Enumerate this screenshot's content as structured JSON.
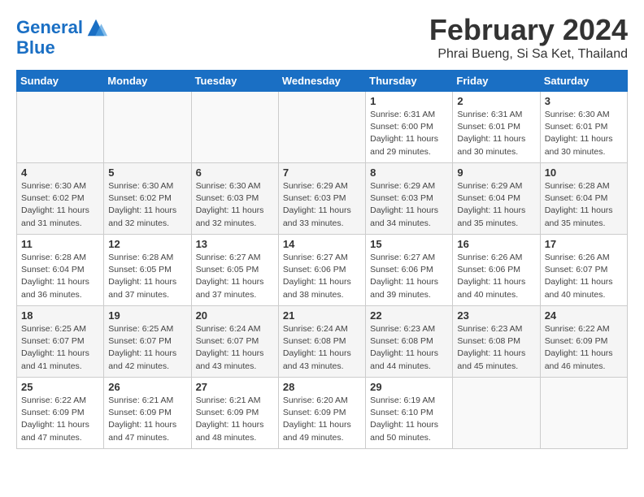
{
  "logo": {
    "line1": "General",
    "line2": "Blue"
  },
  "title": "February 2024",
  "subtitle": "Phrai Bueng, Si Sa Ket, Thailand",
  "days_of_week": [
    "Sunday",
    "Monday",
    "Tuesday",
    "Wednesday",
    "Thursday",
    "Friday",
    "Saturday"
  ],
  "weeks": [
    [
      {
        "day": "",
        "info": ""
      },
      {
        "day": "",
        "info": ""
      },
      {
        "day": "",
        "info": ""
      },
      {
        "day": "",
        "info": ""
      },
      {
        "day": "1",
        "info": "Sunrise: 6:31 AM\nSunset: 6:00 PM\nDaylight: 11 hours\nand 29 minutes."
      },
      {
        "day": "2",
        "info": "Sunrise: 6:31 AM\nSunset: 6:01 PM\nDaylight: 11 hours\nand 30 minutes."
      },
      {
        "day": "3",
        "info": "Sunrise: 6:30 AM\nSunset: 6:01 PM\nDaylight: 11 hours\nand 30 minutes."
      }
    ],
    [
      {
        "day": "4",
        "info": "Sunrise: 6:30 AM\nSunset: 6:02 PM\nDaylight: 11 hours\nand 31 minutes."
      },
      {
        "day": "5",
        "info": "Sunrise: 6:30 AM\nSunset: 6:02 PM\nDaylight: 11 hours\nand 32 minutes."
      },
      {
        "day": "6",
        "info": "Sunrise: 6:30 AM\nSunset: 6:03 PM\nDaylight: 11 hours\nand 32 minutes."
      },
      {
        "day": "7",
        "info": "Sunrise: 6:29 AM\nSunset: 6:03 PM\nDaylight: 11 hours\nand 33 minutes."
      },
      {
        "day": "8",
        "info": "Sunrise: 6:29 AM\nSunset: 6:03 PM\nDaylight: 11 hours\nand 34 minutes."
      },
      {
        "day": "9",
        "info": "Sunrise: 6:29 AM\nSunset: 6:04 PM\nDaylight: 11 hours\nand 35 minutes."
      },
      {
        "day": "10",
        "info": "Sunrise: 6:28 AM\nSunset: 6:04 PM\nDaylight: 11 hours\nand 35 minutes."
      }
    ],
    [
      {
        "day": "11",
        "info": "Sunrise: 6:28 AM\nSunset: 6:04 PM\nDaylight: 11 hours\nand 36 minutes."
      },
      {
        "day": "12",
        "info": "Sunrise: 6:28 AM\nSunset: 6:05 PM\nDaylight: 11 hours\nand 37 minutes."
      },
      {
        "day": "13",
        "info": "Sunrise: 6:27 AM\nSunset: 6:05 PM\nDaylight: 11 hours\nand 37 minutes."
      },
      {
        "day": "14",
        "info": "Sunrise: 6:27 AM\nSunset: 6:06 PM\nDaylight: 11 hours\nand 38 minutes."
      },
      {
        "day": "15",
        "info": "Sunrise: 6:27 AM\nSunset: 6:06 PM\nDaylight: 11 hours\nand 39 minutes."
      },
      {
        "day": "16",
        "info": "Sunrise: 6:26 AM\nSunset: 6:06 PM\nDaylight: 11 hours\nand 40 minutes."
      },
      {
        "day": "17",
        "info": "Sunrise: 6:26 AM\nSunset: 6:07 PM\nDaylight: 11 hours\nand 40 minutes."
      }
    ],
    [
      {
        "day": "18",
        "info": "Sunrise: 6:25 AM\nSunset: 6:07 PM\nDaylight: 11 hours\nand 41 minutes."
      },
      {
        "day": "19",
        "info": "Sunrise: 6:25 AM\nSunset: 6:07 PM\nDaylight: 11 hours\nand 42 minutes."
      },
      {
        "day": "20",
        "info": "Sunrise: 6:24 AM\nSunset: 6:07 PM\nDaylight: 11 hours\nand 43 minutes."
      },
      {
        "day": "21",
        "info": "Sunrise: 6:24 AM\nSunset: 6:08 PM\nDaylight: 11 hours\nand 43 minutes."
      },
      {
        "day": "22",
        "info": "Sunrise: 6:23 AM\nSunset: 6:08 PM\nDaylight: 11 hours\nand 44 minutes."
      },
      {
        "day": "23",
        "info": "Sunrise: 6:23 AM\nSunset: 6:08 PM\nDaylight: 11 hours\nand 45 minutes."
      },
      {
        "day": "24",
        "info": "Sunrise: 6:22 AM\nSunset: 6:09 PM\nDaylight: 11 hours\nand 46 minutes."
      }
    ],
    [
      {
        "day": "25",
        "info": "Sunrise: 6:22 AM\nSunset: 6:09 PM\nDaylight: 11 hours\nand 47 minutes."
      },
      {
        "day": "26",
        "info": "Sunrise: 6:21 AM\nSunset: 6:09 PM\nDaylight: 11 hours\nand 47 minutes."
      },
      {
        "day": "27",
        "info": "Sunrise: 6:21 AM\nSunset: 6:09 PM\nDaylight: 11 hours\nand 48 minutes."
      },
      {
        "day": "28",
        "info": "Sunrise: 6:20 AM\nSunset: 6:09 PM\nDaylight: 11 hours\nand 49 minutes."
      },
      {
        "day": "29",
        "info": "Sunrise: 6:19 AM\nSunset: 6:10 PM\nDaylight: 11 hours\nand 50 minutes."
      },
      {
        "day": "",
        "info": ""
      },
      {
        "day": "",
        "info": ""
      }
    ]
  ]
}
